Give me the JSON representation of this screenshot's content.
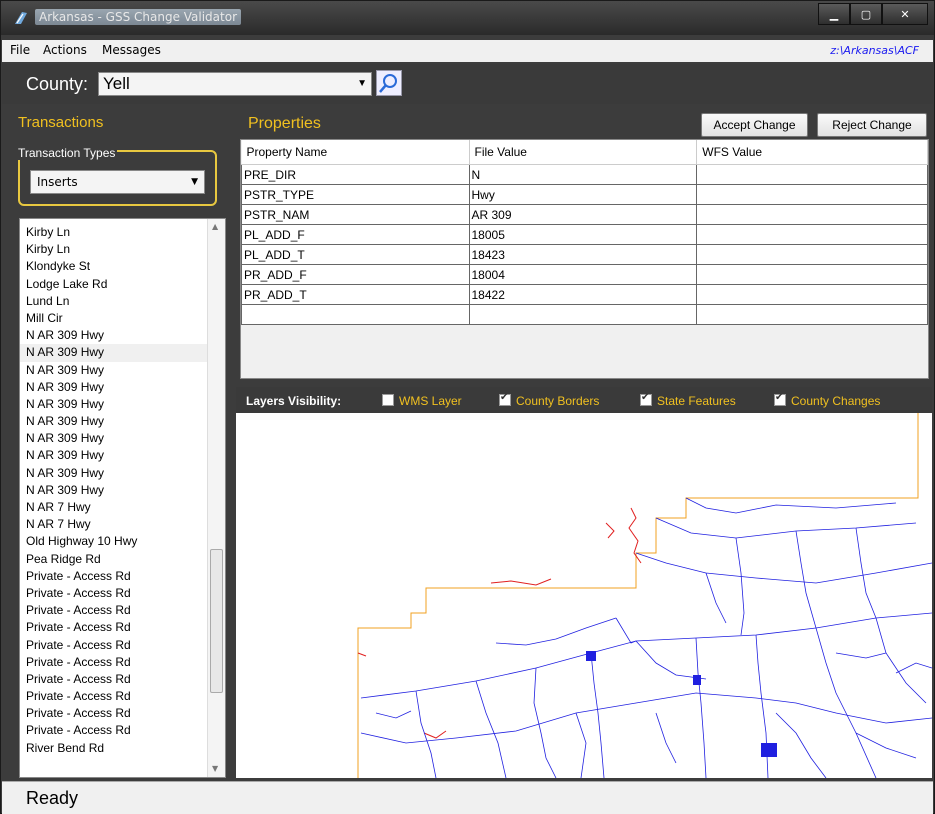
{
  "window": {
    "title": "Arkansas - GSS Change Validator"
  },
  "menu": {
    "items": [
      "File",
      "Actions",
      "Messages"
    ],
    "path": "z:\\Arkansas\\ACF"
  },
  "county": {
    "label": "County:",
    "value": "Yell"
  },
  "transactions": {
    "header": "Transactions",
    "types_label": "Transaction Types",
    "types_value": "Inserts",
    "items": [
      "Kirby Ln",
      "Kirby Ln",
      "Klondyke St",
      "Lodge Lake Rd",
      "Lund Ln",
      "Mill Cir",
      "N AR 309 Hwy",
      "N AR 309 Hwy",
      "N AR 309 Hwy",
      "N AR 309 Hwy",
      "N AR 309 Hwy",
      "N AR 309 Hwy",
      "N AR 309 Hwy",
      "N AR 309 Hwy",
      "N AR 309 Hwy",
      "N AR 309 Hwy",
      "N AR 7 Hwy",
      "N AR 7 Hwy",
      "Old Highway 10 Hwy",
      "Pea Ridge Rd",
      "Private - Access Rd",
      "Private - Access Rd",
      "Private - Access Rd",
      "Private - Access Rd",
      "Private - Access Rd",
      "Private - Access Rd",
      "Private - Access Rd",
      "Private - Access Rd",
      "Private - Access Rd",
      "Private - Access Rd",
      "River Bend Rd"
    ]
  },
  "properties": {
    "header": "Properties",
    "accept_label": "Accept Change",
    "reject_label": "Reject Change",
    "columns": [
      "Property Name",
      "File Value",
      "WFS Value"
    ],
    "rows": [
      [
        "PRE_DIR",
        "N",
        ""
      ],
      [
        "PSTR_TYPE",
        "Hwy",
        ""
      ],
      [
        "PSTR_NAM",
        "AR 309",
        ""
      ],
      [
        "PL_ADD_F",
        "18005",
        ""
      ],
      [
        "PL_ADD_T",
        "18423",
        ""
      ],
      [
        "PR_ADD_F",
        "18004",
        ""
      ],
      [
        "PR_ADD_T",
        "18422",
        ""
      ],
      [
        "",
        "",
        ""
      ]
    ]
  },
  "layers": {
    "label": "Layers Visibility:",
    "items": [
      {
        "label": "WMS Layer",
        "checked": false
      },
      {
        "label": "County Borders",
        "checked": true
      },
      {
        "label": "State Features",
        "checked": true
      },
      {
        "label": "County Changes",
        "checked": true
      }
    ]
  },
  "status": {
    "text": "Ready"
  },
  "colors": {
    "accent": "#f0c020",
    "road": "#2020e0",
    "border": "#f0a020",
    "change": "#e02020"
  }
}
